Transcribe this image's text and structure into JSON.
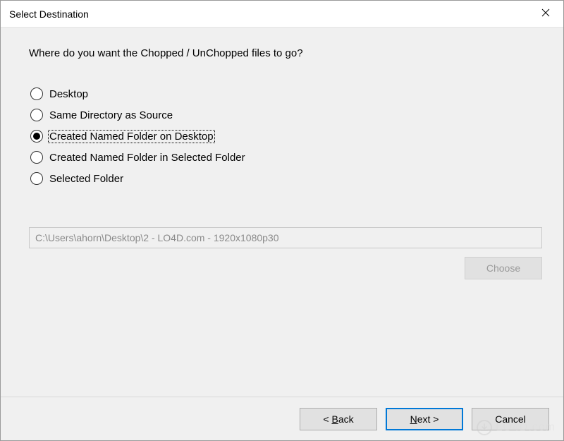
{
  "window": {
    "title": "Select Destination"
  },
  "content": {
    "question": "Where do you want the Chopped / UnChopped files to go?",
    "options": [
      {
        "label": "Desktop",
        "selected": false
      },
      {
        "label": "Same Directory as Source",
        "selected": false
      },
      {
        "label": "Created Named Folder on Desktop",
        "selected": true
      },
      {
        "label": "Created Named Folder in Selected Folder",
        "selected": false
      },
      {
        "label": "Selected Folder",
        "selected": false
      }
    ],
    "path_value": "C:\\Users\\ahorn\\Desktop\\2 - LO4D.com - 1920x1080p30",
    "choose_label": "Choose"
  },
  "buttons": {
    "back_prefix": "< ",
    "back_letter": "B",
    "back_rest": "ack",
    "next_letter": "N",
    "next_rest": "ext >",
    "cancel": "Cancel"
  },
  "watermark": {
    "text": "LO4D.com"
  }
}
